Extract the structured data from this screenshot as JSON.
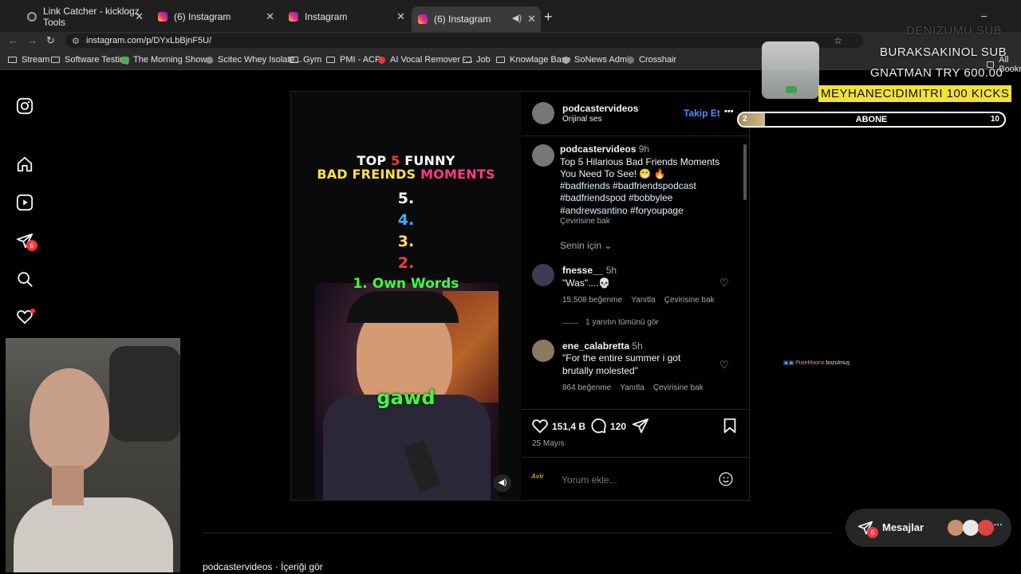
{
  "tabs": [
    {
      "label": "Link Catcher - kicklogz Tools",
      "icon": "globe"
    },
    {
      "label": "(6) Instagram",
      "icon": "instagram"
    },
    {
      "label": "Instagram",
      "icon": "instagram"
    },
    {
      "label": "(6) Instagram",
      "icon": "instagram",
      "active": true
    }
  ],
  "address": {
    "url": "instagram.com/p/DYxLbBjnF5U/"
  },
  "bookmarks": [
    "Stream",
    "Software Testing",
    "The Morning Show...",
    "Scitec Whey Isolate...",
    "Gym",
    "PMI - ACP",
    "AI Vocal Remover -...",
    "Job",
    "Knowlage Base",
    "SoNews Admin",
    "Crosshair",
    "All Bookmarks"
  ],
  "sidebar": {
    "notif_badge": "6"
  },
  "video": {
    "title_line1_a": "TOP ",
    "title_line1_num": "5",
    "title_line1_b": " FUNNY",
    "title_line2_a": "BAD FREINDS ",
    "title_line2_b": "MOMENTS",
    "rank5": "5.",
    "rank4": "4.",
    "rank3": "3.",
    "rank2": "2.",
    "rank1": "1. Own Words",
    "caption": "gawd"
  },
  "header": {
    "username": "podcastervideos",
    "subtitle": "Orijinal ses",
    "follow": "Takip Et",
    "more": "•••"
  },
  "caption": {
    "username": "podcastervideos",
    "time": "9h",
    "text_line1": "Top 5 Hilarious Bad Friends Moments",
    "text_line2": "You Need To See! 😁 🔥",
    "tags_line1": "#badfriends #badfriendspodcast",
    "tags_line2": "#badfriendspod #bobbylee",
    "tags_line3": "#andrewsantino #foryoupage",
    "translate": "Çevirisine bak"
  },
  "sort": {
    "label": "Senin için"
  },
  "comments": [
    {
      "user": "fnesse__",
      "time": "5h",
      "text_line1": "\"Was\"....💀",
      "text_line2": "",
      "likes": "15.508 beğenme",
      "reply": "Yanıtla",
      "translate": "Çevirisine bak",
      "view_replies": "1 yanıtın tümünü gör"
    },
    {
      "user": "ene_calabretta",
      "time": "5h",
      "text_line1": "\"For the entire summer i got",
      "text_line2": "brutally molested\"",
      "likes": "864 beğenme",
      "reply": "Yanıtla",
      "translate": "Çevirisine bak",
      "view_replies": ""
    }
  ],
  "actions": {
    "likes": "151,4 B",
    "comments": "120",
    "date": "25 Mayıs"
  },
  "comment_input": {
    "placeholder": "Yorum ekle..."
  },
  "overlay": {
    "sub_top": "DENIZUMU SUB",
    "line1": "BURAKSAKINOL SUB",
    "line2": "GNATMAN TRY 600.00",
    "line3": "MEYHANECIDIMITRI 100 KICKS",
    "goal_label": "ABONE",
    "goal_start": "2",
    "goal_end": "10",
    "goal_progress": 0.1,
    "chat_user": "PixieMoonx",
    "chat_text": "bozulmuş"
  },
  "messages": {
    "label": "Mesajlar",
    "badge": "6"
  },
  "footer": {
    "text": "podcastervideos · İçeriği gör"
  }
}
